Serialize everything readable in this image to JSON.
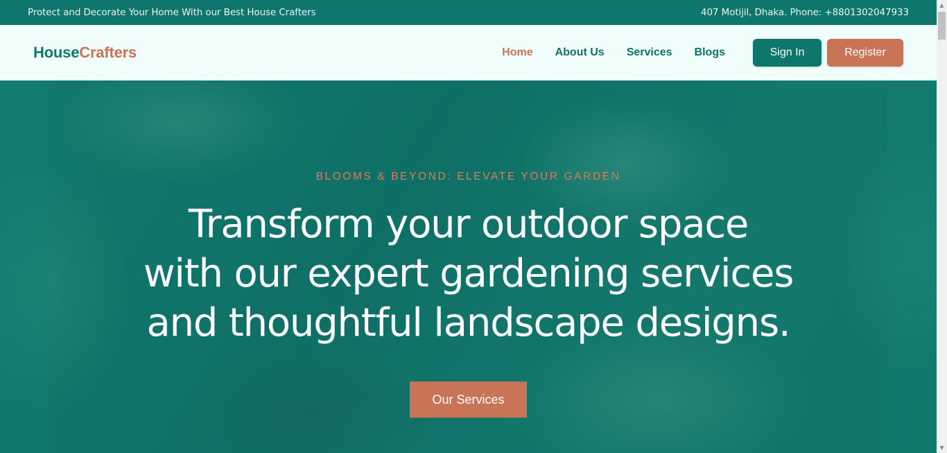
{
  "topbar": {
    "tagline": "Protect and Decorate Your Home With our Best House Crafters",
    "contact": "407 Motijil, Dhaka. Phone: +8801302047933"
  },
  "navbar": {
    "logo_part1": "House",
    "logo_part2": "Crafters",
    "links": [
      {
        "label": "Home",
        "active": true
      },
      {
        "label": "About Us",
        "active": false
      },
      {
        "label": "Services",
        "active": false
      },
      {
        "label": "Blogs",
        "active": false
      }
    ],
    "signin_label": "Sign In",
    "register_label": "Register"
  },
  "hero": {
    "eyebrow": "BLOOMS & BEYOND: ELEVATE YOUR GARDEN",
    "headline_lines": [
      "Transform your outdoor space",
      "with our expert gardening services",
      "and thoughtful landscape designs."
    ],
    "cta_label": "Our Services"
  },
  "scrollbar": {
    "up_icon": "▲",
    "down_icon": "▼"
  },
  "colors": {
    "primary": "#0f766e",
    "accent": "#c97456",
    "nav_bg": "#f0fdfb"
  }
}
